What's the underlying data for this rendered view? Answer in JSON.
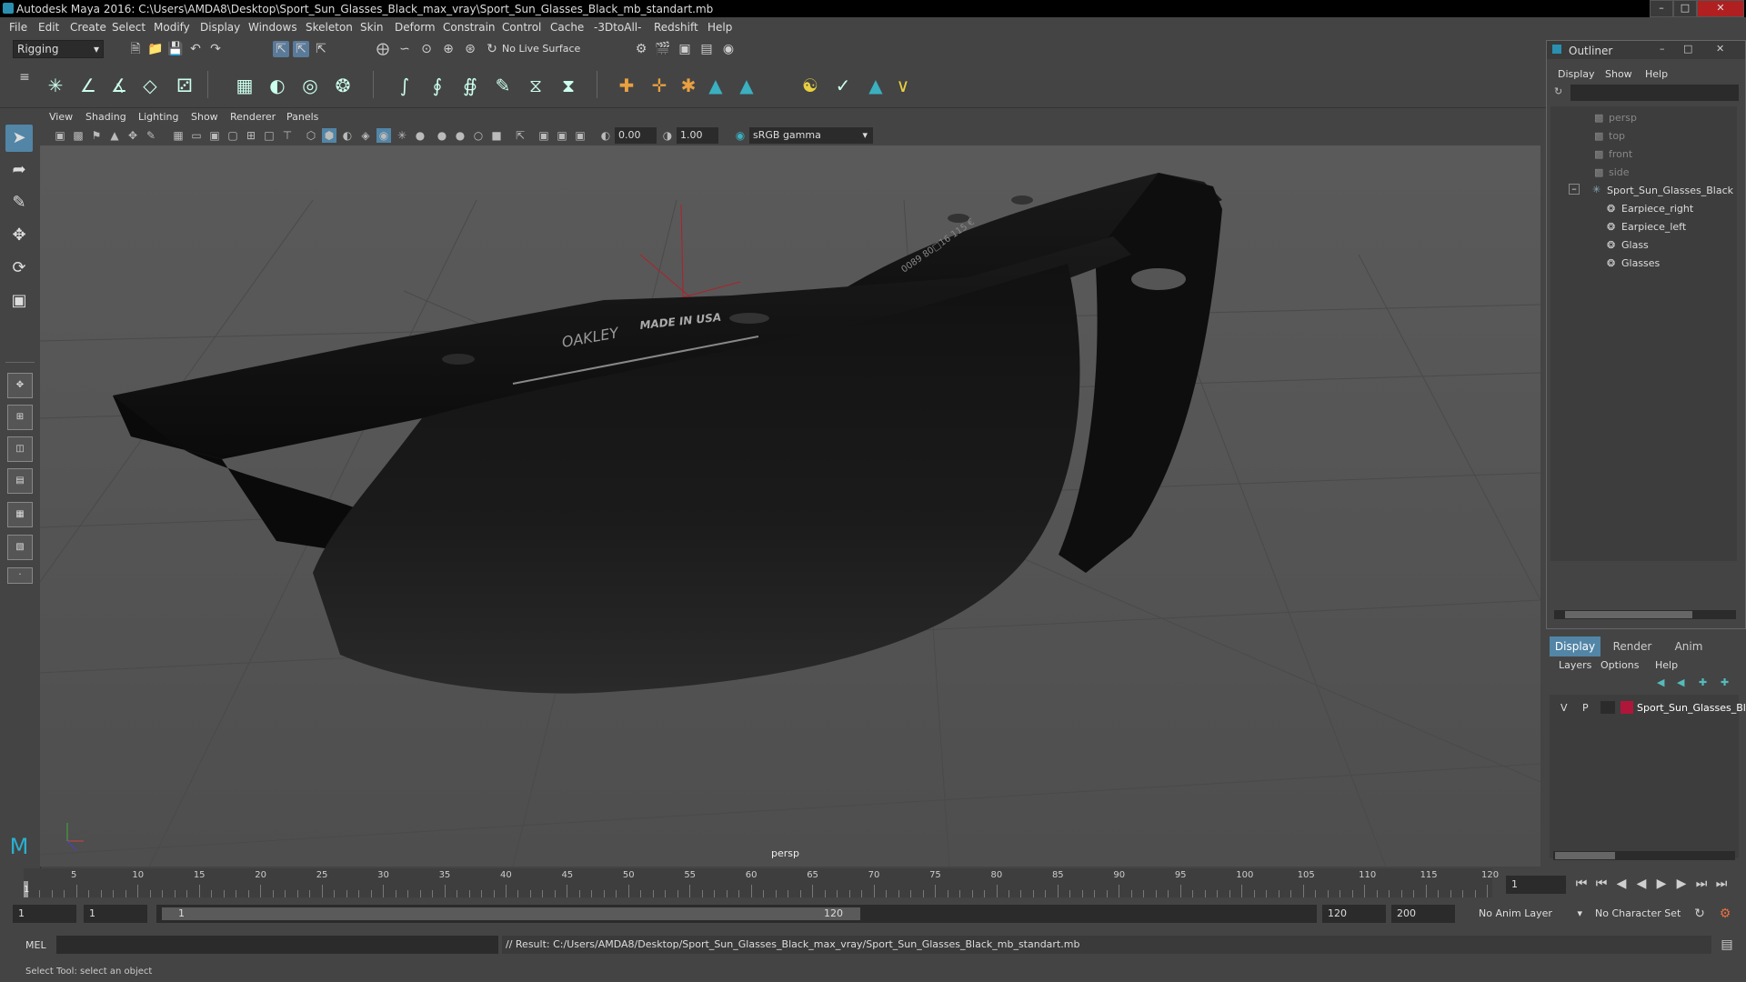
{
  "window": {
    "title": "Autodesk Maya 2016: C:\\Users\\AMDA8\\Desktop\\Sport_Sun_Glasses_Black_max_vray\\Sport_Sun_Glasses_Black_mb_standart.mb"
  },
  "menubar": [
    "File",
    "Edit",
    "Create",
    "Select",
    "Modify",
    "Display",
    "Windows",
    "Skeleton",
    "Skin",
    "Deform",
    "Constrain",
    "Control",
    "Cache",
    "-3DtoAll-",
    "Redshift",
    "Help"
  ],
  "statusline": {
    "menuset": "Rigging",
    "live_surface": "No Live Surface"
  },
  "panel_menu": [
    "View",
    "Shading",
    "Lighting",
    "Show",
    "Renderer",
    "Panels"
  ],
  "view_toolbar": {
    "exposure": "0.00",
    "gamma": "1.00",
    "color_space": "sRGB gamma"
  },
  "viewport": {
    "camera_label": "persp",
    "model_text_1": "OAKLEY",
    "model_text_2": "MADE IN USA",
    "model_text_3": "0089 80□16 115 €"
  },
  "outliner": {
    "title": "Outliner",
    "menus": [
      "Display",
      "Show",
      "Help"
    ],
    "cameras": [
      "persp",
      "top",
      "front",
      "side"
    ],
    "group": "Sport_Sun_Glasses_Black",
    "children": [
      "Earpiece_right",
      "Earpiece_left",
      "Glass",
      "Glasses"
    ]
  },
  "layer_editor": {
    "tabs": [
      "Display",
      "Render",
      "Anim"
    ],
    "menus": [
      "Layers",
      "Options",
      "Help"
    ],
    "layer": {
      "v": "V",
      "p": "P",
      "name": "Sport_Sun_Glasses_Bla",
      "color": "#b0163a"
    }
  },
  "timeline": {
    "ticks": [
      "5",
      "10",
      "15",
      "20",
      "25",
      "30",
      "35",
      "40",
      "45",
      "50",
      "55",
      "60",
      "65",
      "70",
      "75",
      "80",
      "85",
      "90",
      "95",
      "100",
      "105",
      "110",
      "115",
      "120"
    ],
    "start_marker": "1",
    "current_frame": "1"
  },
  "range": {
    "start": "1",
    "playback_start": "1",
    "slider_start": "1",
    "slider_end": "120",
    "playback_end": "120",
    "end": "200",
    "anim_layer": "No Anim Layer",
    "character_set": "No Character Set"
  },
  "command_line": {
    "mode": "MEL",
    "result": "// Result: C:/Users/AMDA8/Desktop/Sport_Sun_Glasses_Black_max_vray/Sport_Sun_Glasses_Black_mb_standart.mb"
  },
  "help_line": "Select Tool: select an object"
}
